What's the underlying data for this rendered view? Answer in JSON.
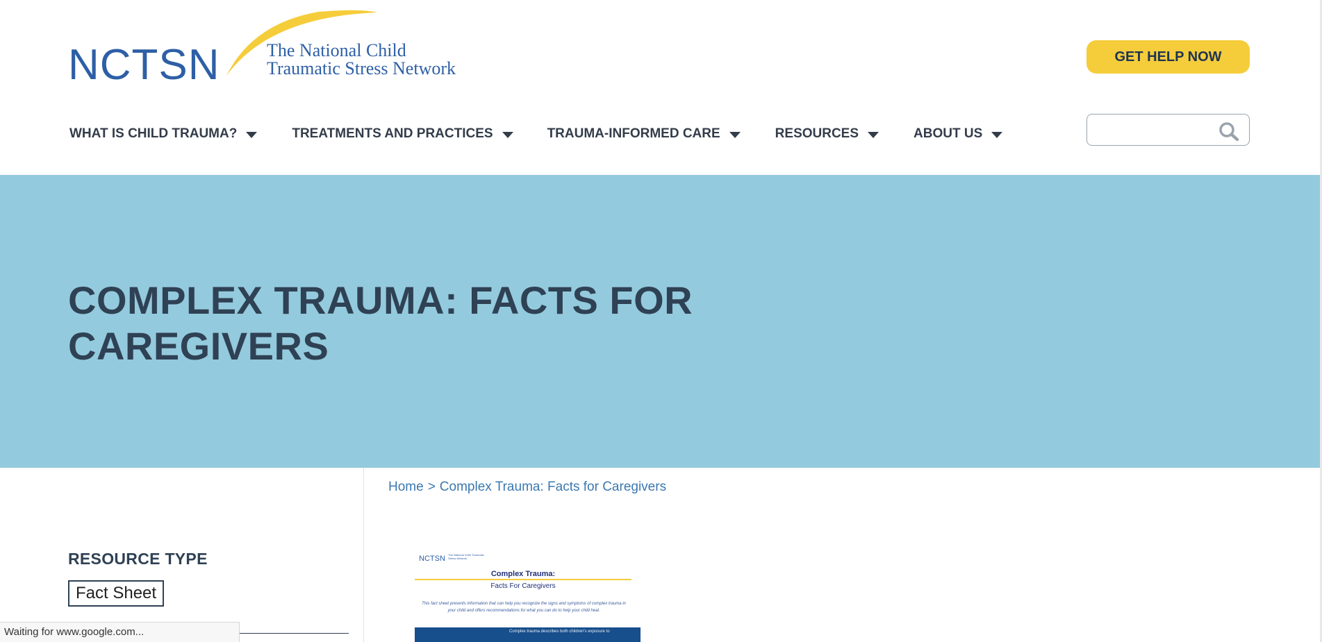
{
  "header": {
    "logo_acronym": "NCTSN",
    "logo_line1": "The National Child",
    "logo_line2": "Traumatic Stress Network",
    "help_button": "GET HELP NOW",
    "nav": [
      {
        "label": "WHAT IS CHILD TRAUMA?"
      },
      {
        "label": "TREATMENTS AND PRACTICES"
      },
      {
        "label": "TRAUMA-INFORMED CARE"
      },
      {
        "label": "RESOURCES"
      },
      {
        "label": "ABOUT US"
      }
    ],
    "search": {
      "value": "",
      "placeholder": ""
    }
  },
  "hero": {
    "title_line1": "COMPLEX TRAUMA: FACTS FOR",
    "title_line2": "CAREGIVERS"
  },
  "breadcrumb": {
    "home": "Home",
    "separator": ">",
    "current": "Complex Trauma: Facts for Caregivers"
  },
  "sidebar": {
    "resource_type_title": "RESOURCE TYPE",
    "resource_type_value": "Fact Sheet"
  },
  "thumbnail": {
    "acronym": "NCTSN",
    "subtitle": "The National Child Traumatic Stress Network",
    "heading": "Complex Trauma:",
    "subheading": "Facts For Caregivers",
    "body": "This fact sheet presents information that can help you recognize the signs and symptoms of complex trauma in your child and offers recommendations for what you can do to help your child heal.",
    "band_text": "Complex trauma describes both children's exposure to"
  },
  "status_bar": {
    "text": "Waiting for www.google.com..."
  },
  "colors": {
    "brand_blue": "#2e5fa6",
    "help_yellow": "#f5cd3b",
    "hero_bg": "#94cadd",
    "heading_text": "#2f4154",
    "link_blue": "#3b78b0"
  }
}
